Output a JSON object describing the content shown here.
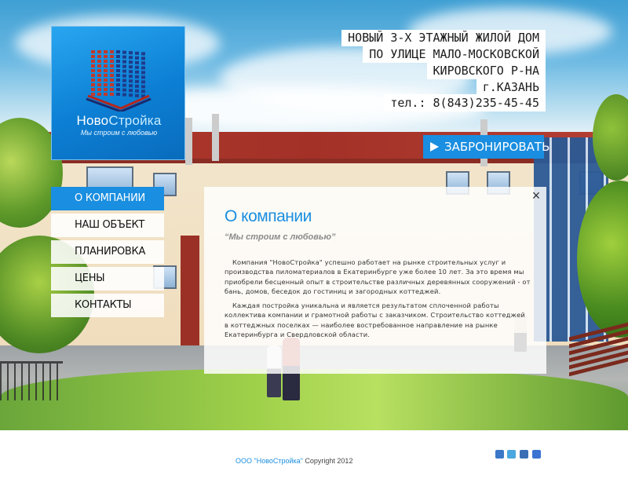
{
  "logo": {
    "brand_part1": "Ново",
    "brand_part2": "Стройка",
    "slogan": "Мы строим с любовью"
  },
  "header": {
    "lines": [
      "НОВЫЙ 3-Х ЭТАЖНЫЙ ЖИЛОЙ ДОМ",
      "ПО УЛИЦЕ МАЛО-МОСКОВСКОЙ",
      "КИРОВСКОГО Р-НА",
      "г.КАЗАНЬ",
      "тел.: 8(843)235-45-45"
    ],
    "book_button": "ЗАБРОНИРОВАТЬ"
  },
  "nav": {
    "items": [
      {
        "label": "О КОМПАНИИ",
        "active": true
      },
      {
        "label": "НАШ ОБЪЕКТ",
        "active": false
      },
      {
        "label": "ПЛАНИРОВКА",
        "active": false
      },
      {
        "label": "ЦЕНЫ",
        "active": false
      },
      {
        "label": "КОНТАКТЫ",
        "active": false
      }
    ]
  },
  "panel": {
    "close": "×",
    "title": "О компании",
    "subtitle": "“Мы строим с любовью”",
    "paragraph1": "Компания \"НовоСтройка\" успешно работает на рынке строительных услуг и производства пиломатериалов в Екатеринбурге уже более 10 лет. За это время мы приобрели бесценный опыт в строительстве различных деревянных сооружений - от бань, домов, беседок до гостиниц и загородных коттеджей.",
    "paragraph2": "Каждая постройка уникальна и является результатом сплоченной работы коллектива компании и грамотной работы с заказчиком. Строительство коттеджей в коттеджных поселках — наиболее востребованное направление на рынке Екатеринбурга и Свердловской области."
  },
  "footer": {
    "company": "ООО \"НовоСтройка\"",
    "copyright": "Copyright 2012",
    "social": [
      {
        "icon": "facebook-icon",
        "color": "#3b79c8"
      },
      {
        "icon": "twitter-icon",
        "color": "#4aa7df"
      },
      {
        "icon": "linkedin-icon",
        "color": "#3a6fb5"
      },
      {
        "icon": "delicious-icon",
        "color": "#3a74d2"
      }
    ]
  },
  "colors": {
    "accent": "#1a8ee0",
    "logo_bg": "#0c7fd4"
  }
}
